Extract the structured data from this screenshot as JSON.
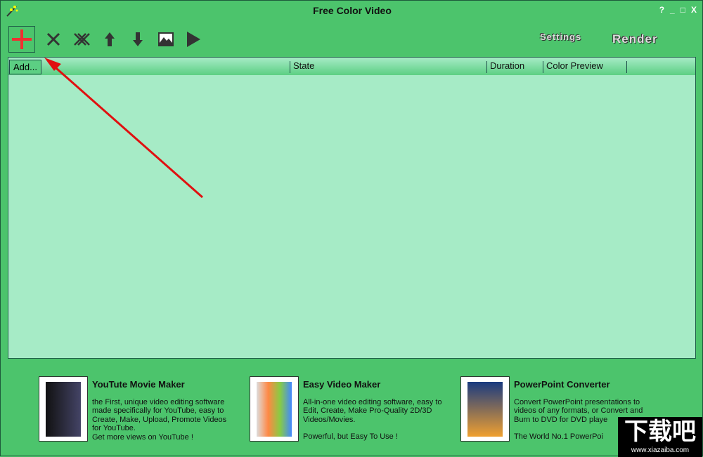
{
  "window": {
    "title": "Free Color Video",
    "help": "?",
    "minimize": "_",
    "maximize": "□",
    "close": "X"
  },
  "toolbar": {
    "add": "add-icon",
    "remove": "remove-icon",
    "remove_all": "remove-all-icon",
    "up": "arrow-up-icon",
    "down": "arrow-down-icon",
    "image": "image-icon",
    "play": "play-icon",
    "settings_label": "Settings",
    "render_label": "Render",
    "add_tooltip": "Add..."
  },
  "list": {
    "columns": [
      "State",
      "Duration",
      "Color Preview"
    ]
  },
  "promos": [
    {
      "title": "YouTute Movie Maker",
      "lines": [
        "the First, unique video editing software made specifically for YouTube, easy to Create, Make, Upload, Promote Videos for YouTube.",
        "Get more views on YouTube !"
      ]
    },
    {
      "title": "Easy Video Maker",
      "lines": [
        "All-in-one video editing software, easy to Edit, Create, Make Pro-Quality 2D/3D Videos/Movies.",
        "Powerful, but Easy To Use !"
      ]
    },
    {
      "title": "PowerPoint Converter",
      "lines": [
        "Convert PowerPoint presentations to videos of any formats, or Convert and Burn to DVD for DVD playe",
        "The World No.1 PowerPoi"
      ]
    }
  ],
  "watermark": {
    "big": "下载吧",
    "small": "www.xiazaiba.com"
  },
  "colors": {
    "background": "#4cc46c",
    "list": "#a6ebc6",
    "arrow": "#e01010"
  }
}
